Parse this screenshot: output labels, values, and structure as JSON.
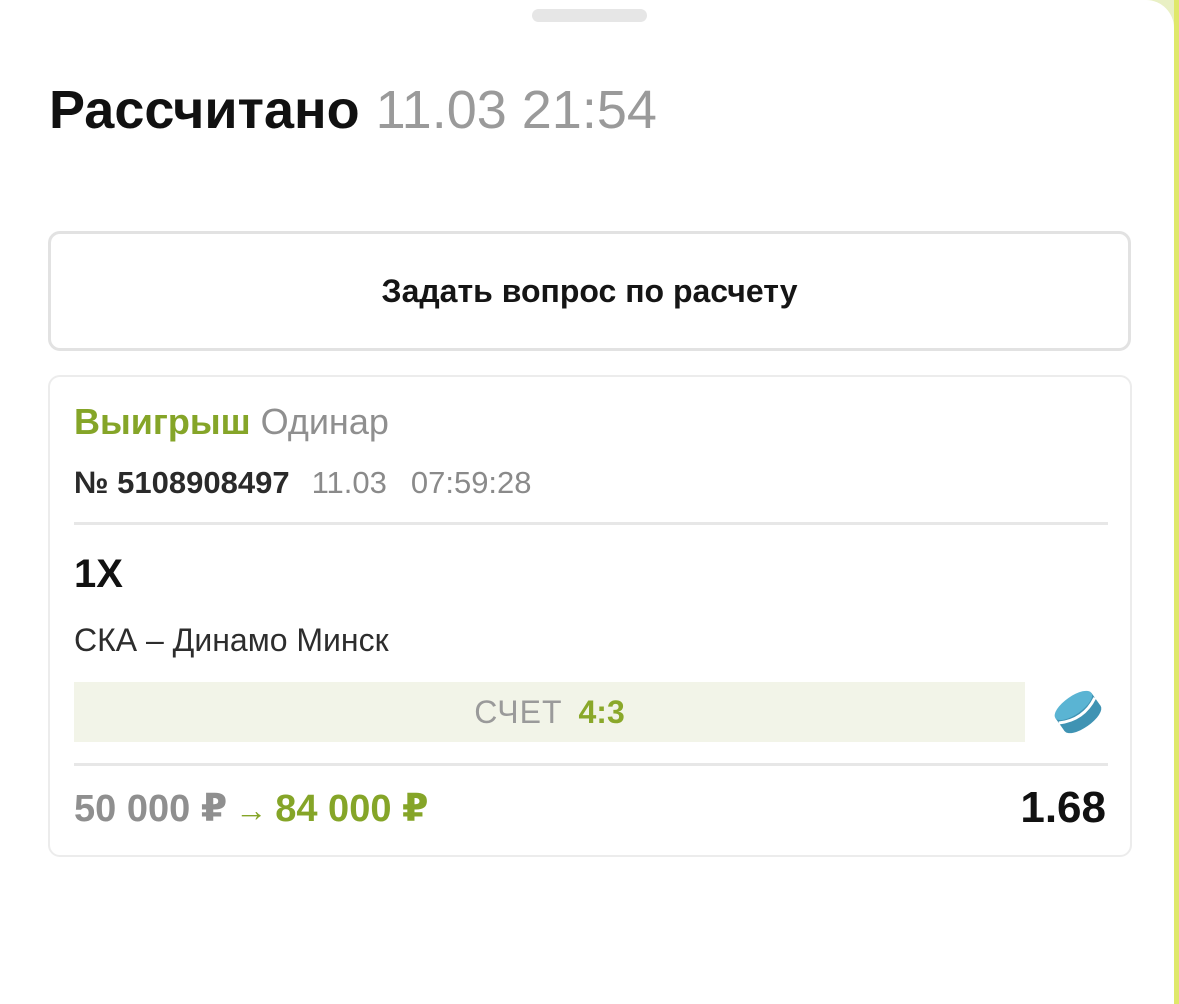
{
  "header": {
    "title": "Рассчитано",
    "settled_time": "11.03 21:54"
  },
  "ask_button": {
    "label": "Задать вопрос по расчету"
  },
  "bet": {
    "status": "Выигрыш",
    "type": "Одинар",
    "number": "№ 5108908497",
    "date": "11.03",
    "time": "07:59:28",
    "outcome": "1X",
    "match": "СКА – Динамо Минск",
    "score_label": "СЧЕТ",
    "score_value": "4:3",
    "sport_icon": "hockey-puck-icon",
    "stake": "50 000 ₽",
    "arrow": "→",
    "payout": "84 000 ₽",
    "odds": "1.68"
  },
  "colors": {
    "accent_green": "#85a528",
    "score_background": "#f2f4e8",
    "puck_blue": "#4aa9c9"
  }
}
